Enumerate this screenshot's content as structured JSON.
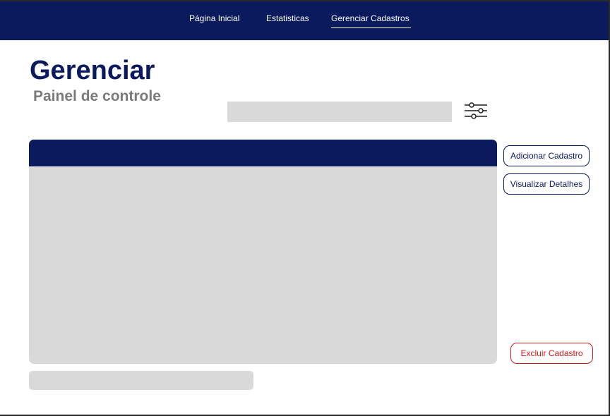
{
  "nav": {
    "items": [
      {
        "label": "Página Inicial"
      },
      {
        "label": "Estatisticas"
      },
      {
        "label": "Gerenciar Cadastros",
        "active": true
      }
    ]
  },
  "page": {
    "title": "Gerenciar",
    "subtitle": "Painel de controle"
  },
  "search": {
    "value": "",
    "placeholder": ""
  },
  "filter": {
    "icon": "sliders-icon"
  },
  "actions": {
    "add_label": "Adicionar Cadastro",
    "view_label": "Visualizar Detalhes",
    "delete_label": "Excluir Cadastro"
  },
  "colors": {
    "primary": "#0a1a5c",
    "panel": "#d9d9d9",
    "subtitle": "#7a7a7a",
    "danger": "#d11a1a"
  }
}
